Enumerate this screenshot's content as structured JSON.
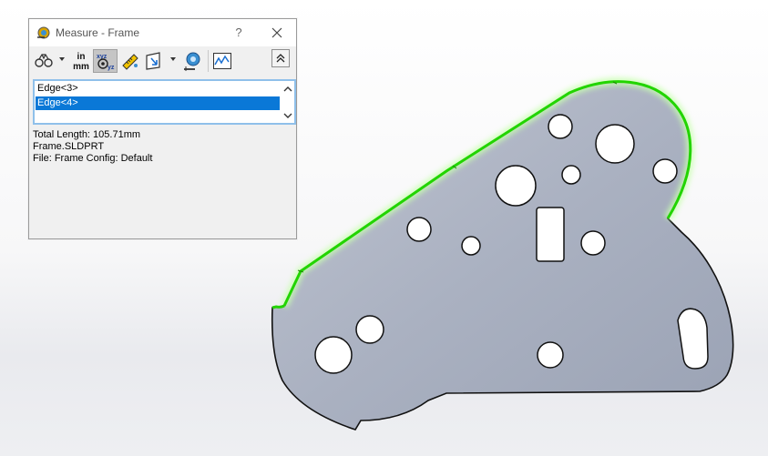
{
  "dialog": {
    "title": "Measure - Frame",
    "help_label": "?",
    "toolbar": [
      {
        "name": "arc-circle-measurements-icon"
      },
      {
        "name": "units-precision-icon",
        "label_top": "in",
        "label_bottom": "mm"
      },
      {
        "name": "show-xyz-measurements-icon",
        "pressed": true
      },
      {
        "name": "point-to-point-icon"
      },
      {
        "name": "projected-on-icon"
      },
      {
        "name": "create-sensor-icon"
      },
      {
        "name": "measurement-history-icon"
      }
    ],
    "selections": [
      {
        "label": "Edge<3>",
        "selected": false
      },
      {
        "label": "Edge<4>",
        "selected": true
      }
    ],
    "results": [
      "Total Length: 105.71mm",
      "Frame.SLDPRT",
      "File: Frame Config: Default"
    ]
  },
  "colors": {
    "selection_highlight": "#0a78d7",
    "edge_highlight": "#22d400",
    "part_face": "#adb3c2"
  }
}
